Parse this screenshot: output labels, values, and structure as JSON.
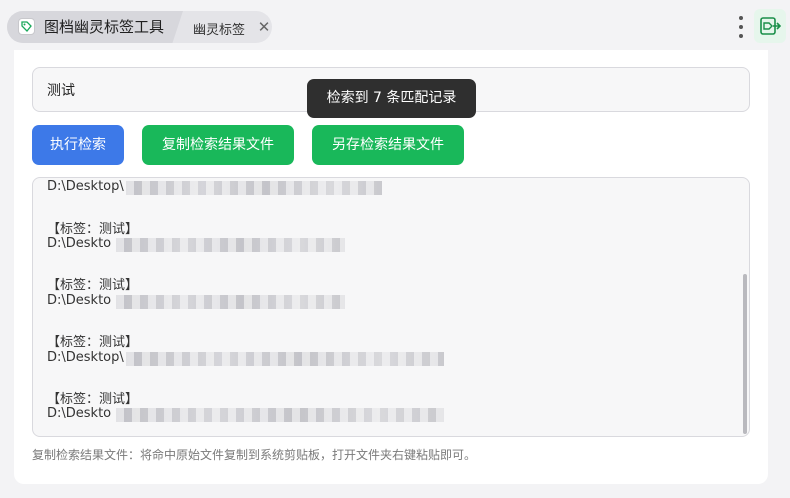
{
  "tabs": {
    "main_label": "图档幽灵标签工具",
    "sub_label": "幽灵标签",
    "close_symbol": "✕"
  },
  "search": {
    "value": "测试"
  },
  "tooltip": "检索到 7 条匹配记录",
  "buttons": {
    "execute": "执行检索",
    "copy_files": "复制检索结果文件",
    "save_as": "另存检索结果文件"
  },
  "results": [
    {
      "tag": "",
      "path": "D:\\Desktop\\"
    },
    {
      "tag": "【标签：测试】",
      "path": "D:\\Deskto"
    },
    {
      "tag": "【标签：测试】",
      "path": "D:\\Deskto"
    },
    {
      "tag": "【标签：测试】",
      "path": "D:\\Desktop\\"
    },
    {
      "tag": "【标签：测试】",
      "path": "D:\\Deskto"
    }
  ],
  "hint": "复制检索结果文件：将命中原始文件复制到系统剪贴板，打开文件夹右键粘贴即可。",
  "icons": {
    "tab_icon": "tag-icon",
    "menu": "kebab-menu-icon",
    "app": "tag-export-icon"
  },
  "colors": {
    "primary_blue": "#3d79e8",
    "action_green": "#19b85a",
    "tooltip_bg": "#2f2f2f"
  }
}
